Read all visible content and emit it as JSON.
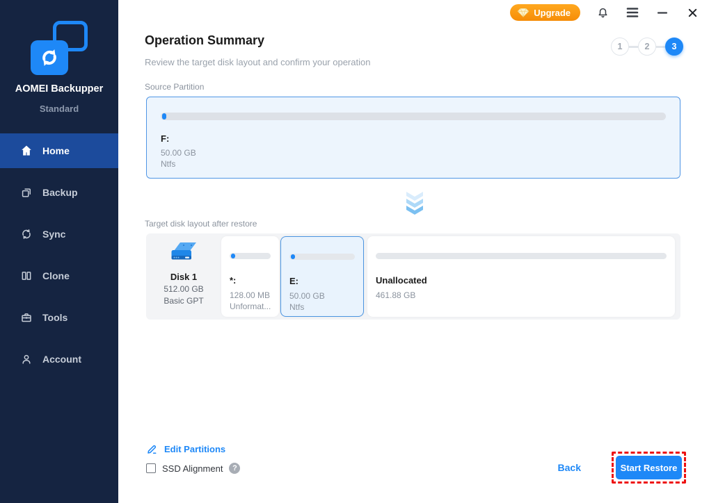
{
  "app": {
    "name": "AOMEI Backupper",
    "edition": "Standard"
  },
  "titlebar": {
    "upgrade_label": "Upgrade",
    "icons": [
      "gem-icon",
      "bell-icon",
      "menu-icon",
      "minimize-icon",
      "close-icon"
    ]
  },
  "sidebar": {
    "items": [
      {
        "label": "Home",
        "icon": "home-icon",
        "active": true
      },
      {
        "label": "Backup",
        "icon": "backup-icon",
        "active": false
      },
      {
        "label": "Sync",
        "icon": "sync-icon",
        "active": false
      },
      {
        "label": "Clone",
        "icon": "clone-icon",
        "active": false
      },
      {
        "label": "Tools",
        "icon": "tools-icon",
        "active": false
      },
      {
        "label": "Account",
        "icon": "account-icon",
        "active": false
      }
    ]
  },
  "page": {
    "title": "Operation Summary",
    "subtitle": "Review the target disk layout and confirm your operation",
    "steps": [
      "1",
      "2",
      "3"
    ],
    "active_step": "3"
  },
  "source": {
    "label": "Source Partition",
    "partition": {
      "name": "F:",
      "size": "50.00 GB",
      "fs": "Ntfs"
    }
  },
  "target": {
    "label": "Target disk layout after restore",
    "disk": {
      "name": "Disk 1",
      "size": "512.00 GB",
      "type": "Basic GPT"
    },
    "partitions": [
      {
        "name": "*:",
        "size": "128.00 MB",
        "fs": "Unformat...",
        "selected": false
      },
      {
        "name": "E:",
        "size": "50.00 GB",
        "fs": "Ntfs",
        "selected": true
      },
      {
        "name": "Unallocated",
        "size": "461.88 GB",
        "fs": "",
        "selected": false
      }
    ]
  },
  "footer": {
    "edit_partitions_label": "Edit Partitions",
    "ssd_alignment_label": "SSD Alignment",
    "ssd_alignment_checked": false,
    "help_glyph": "?",
    "back_label": "Back",
    "start_restore_label": "Start Restore"
  },
  "colors": {
    "accent_blue": "#1e88f7",
    "sidebar_navy": "#152441",
    "active_item_blue": "#1c4b9c",
    "upgrade_orange": "#f68d08",
    "highlight_red": "#ee1111",
    "selected_card_border": "#4a94e0"
  }
}
